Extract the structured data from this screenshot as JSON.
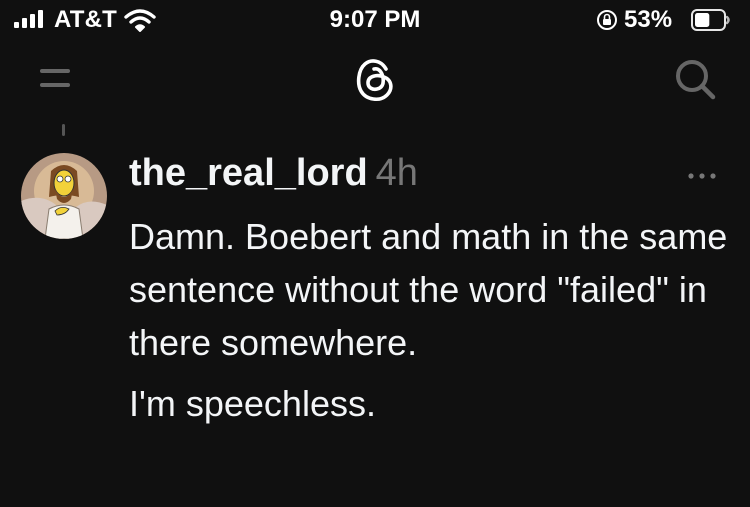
{
  "status_bar": {
    "carrier": "AT&T",
    "time": "9:07 PM",
    "battery_percent": "53%",
    "battery_level": 0.53,
    "icons": [
      "signal-icon",
      "wifi-icon",
      "rotation-lock-icon",
      "battery-icon"
    ]
  },
  "nav": {
    "icons": [
      "menu-icon",
      "threads-logo-icon",
      "search-icon"
    ]
  },
  "post": {
    "username": "the_real_lord",
    "time": "4h",
    "more_icon": "ellipsis-icon",
    "paragraphs": [
      "Damn. Boebert and math in the same sentence without the word \"failed\" in there somewhere.",
      "I'm speechless."
    ]
  },
  "colors": {
    "background": "#101010",
    "text": "#f3f5f7",
    "muted": "#777777"
  }
}
